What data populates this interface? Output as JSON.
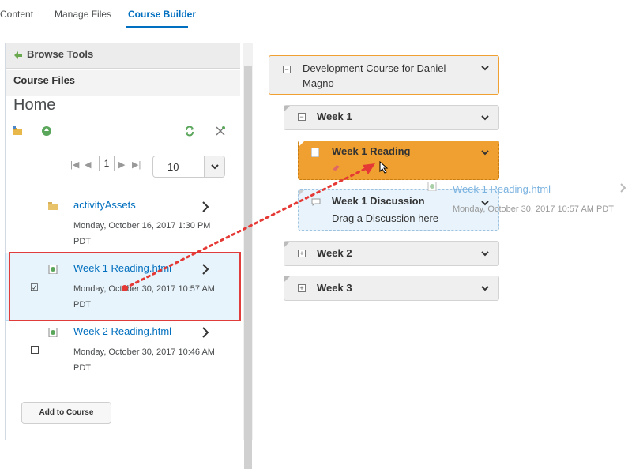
{
  "tabs": [
    {
      "label": "Content"
    },
    {
      "label": "Manage Files"
    },
    {
      "label": "Course Builder"
    }
  ],
  "left_panel": {
    "browse_tools": "Browse Tools",
    "section_title": "Course Files",
    "folder_title": "Home",
    "pager": {
      "current_page": "1",
      "page_size": "10"
    },
    "files": [
      {
        "name": "activityAssets",
        "meta": "Monday, October 16, 2017 1:30 PM PDT",
        "icon": "folder-icon"
      },
      {
        "name": "Week 1 Reading.html",
        "meta": "Monday, October 30, 2017 10:57 AM PDT",
        "icon": "html-file-icon",
        "checked": true
      },
      {
        "name": "Week 2 Reading.html",
        "meta": "Monday, October 30, 2017 10:46 AM PDT",
        "icon": "html-file-icon",
        "checked": false
      }
    ],
    "add_button": "Add to Course",
    "checkmark": "☑"
  },
  "tree": {
    "root": "Development Course for Daniel Magno",
    "week1": "Week 1",
    "week1_reading": "Week 1 Reading",
    "week1_discussion": "Week 1 Discussion",
    "week1_discussion_hint": "Drag a Discussion here",
    "week2": "Week 2",
    "week3": "Week 3",
    "collapse_symbol": "−",
    "expand_symbol": "+"
  },
  "drag_ghost": {
    "name": "Week 1 Reading.html",
    "meta": "Monday, October 30, 2017 10:57 AM PDT"
  },
  "colors": {
    "accent": "#006fbf",
    "drag_orange": "#f0a030",
    "highlight_red": "#e03c3c"
  }
}
